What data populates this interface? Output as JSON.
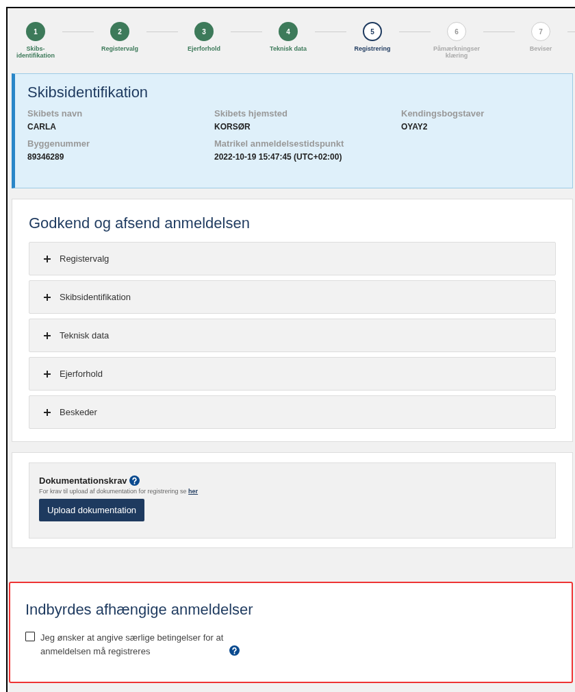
{
  "steps": [
    {
      "number": "1",
      "label": "Skibs-identifikation",
      "completed": true,
      "selected": false
    },
    {
      "number": "2",
      "label": "Registervalg",
      "completed": true,
      "selected": false
    },
    {
      "number": "3",
      "label": "Ejerforhold",
      "completed": true,
      "selected": false
    },
    {
      "number": "4",
      "label": "Teknisk data",
      "completed": true,
      "selected": false
    },
    {
      "number": "5",
      "label": "Registrering",
      "completed": false,
      "selected": true
    },
    {
      "number": "6",
      "label": "Påmærkningser klæring",
      "completed": false,
      "selected": false
    },
    {
      "number": "7",
      "label": "Beviser",
      "completed": false,
      "selected": false
    }
  ],
  "ship_identification": {
    "title": "Skibsidentifikation",
    "fields": [
      {
        "label": "Skibets navn",
        "value": "CARLA"
      },
      {
        "label": "Skibets hjemsted",
        "value": "KORSØR"
      },
      {
        "label": "Kendingsbogstaver",
        "value": "OYAY2"
      },
      {
        "label": "Byggenummer",
        "value": "89346289"
      },
      {
        "label": "Matrikel anmeldelsestidspunkt",
        "value": "2022-10-19 15:47:45 (UTC+02:00)"
      }
    ]
  },
  "review": {
    "title": "Godkend og afsend anmeldelsen",
    "sections": [
      {
        "label": "Registervalg",
        "expanded": false
      },
      {
        "label": "Skibsidentifikation",
        "expanded": false
      },
      {
        "label": "Teknisk data",
        "expanded": false
      },
      {
        "label": "Ejerforhold",
        "expanded": false
      },
      {
        "label": "Beskeder",
        "expanded": false
      }
    ]
  },
  "documentation": {
    "title": "Dokumentationskrav",
    "text": "For krav til upload af dokumentation for registrering se",
    "link": "her",
    "button": "Upload dokumentation"
  },
  "dependencies": {
    "title": "Indbyrdes afhængige anmeldelser",
    "checkbox_label": "Jeg ønsker at angive særlige betingelser for at anmeldelsen må registreres",
    "checked": false
  }
}
